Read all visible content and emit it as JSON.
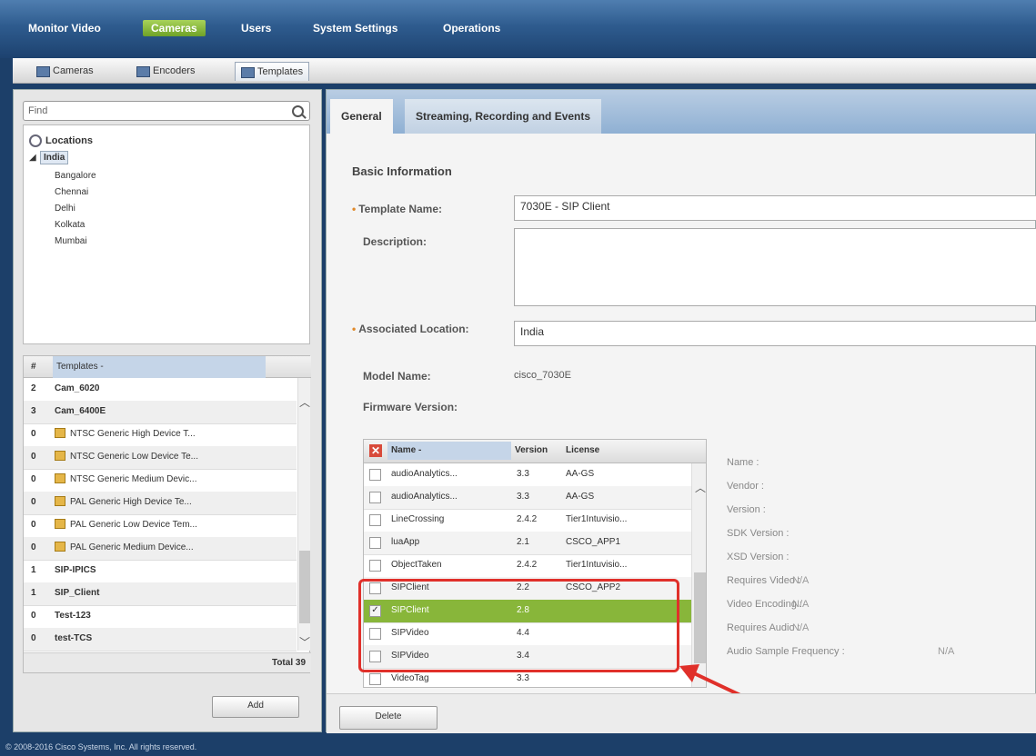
{
  "nav": {
    "tabs": [
      {
        "label": "Monitor Video",
        "active": false
      },
      {
        "label": "Cameras",
        "active": true
      },
      {
        "label": "Users",
        "active": false
      },
      {
        "label": "System Settings",
        "active": false
      },
      {
        "label": "Operations",
        "active": false
      }
    ]
  },
  "subnav": {
    "tabs": [
      {
        "label": "Cameras",
        "icon": "camera-icon",
        "active": false
      },
      {
        "label": "Encoders",
        "icon": "encoder-icon",
        "active": false
      },
      {
        "label": "Templates",
        "icon": "template-icon",
        "active": true
      }
    ]
  },
  "left": {
    "find_placeholder": "Find",
    "tree_root": "Locations",
    "tree_selected": "India",
    "tree_children": [
      "Bangalore",
      "Chennai",
      "Delhi",
      "Kolkata",
      "Mumbai"
    ],
    "grid_header": {
      "col1": "#",
      "col2": "Templates -"
    },
    "templates": [
      {
        "count": "2",
        "name": "Cam_6020",
        "locked": false
      },
      {
        "count": "3",
        "name": "Cam_6400E",
        "locked": false
      },
      {
        "count": "0",
        "name": "NTSC Generic High Device T...",
        "locked": true
      },
      {
        "count": "0",
        "name": "NTSC Generic Low Device Te...",
        "locked": true
      },
      {
        "count": "0",
        "name": "NTSC Generic Medium Devic...",
        "locked": true
      },
      {
        "count": "0",
        "name": "PAL Generic High Device Te...",
        "locked": true
      },
      {
        "count": "0",
        "name": "PAL Generic Low Device Tem...",
        "locked": true
      },
      {
        "count": "0",
        "name": "PAL Generic Medium Device...",
        "locked": true
      },
      {
        "count": "1",
        "name": "SIP-IPICS",
        "locked": false
      },
      {
        "count": "1",
        "name": "SIP_Client",
        "locked": false
      },
      {
        "count": "0",
        "name": "Test-123",
        "locked": false
      },
      {
        "count": "0",
        "name": "test-TCS",
        "locked": false
      }
    ],
    "total": "Total 39",
    "add_label": "Add"
  },
  "right": {
    "tabs": [
      "General",
      "Streaming, Recording and Events"
    ],
    "section_title": "Basic Information",
    "template_name_label": "Template Name:",
    "template_name_value": "7030E - SIP Client",
    "description_label": "Description:",
    "description_value": "",
    "location_label": "Associated Location:",
    "location_value": "India",
    "model_label": "Model Name:",
    "model_value": "cisco_7030E",
    "firmware_label": "Firmware Version:",
    "apps_header": {
      "name": "Name -",
      "version": "Version",
      "license": "License"
    },
    "apps": [
      {
        "name": "audioAnalytics...",
        "version": "3.3",
        "license": "AA-GS",
        "checked": false,
        "selected": false
      },
      {
        "name": "audioAnalytics...",
        "version": "3.3",
        "license": "AA-GS",
        "checked": false,
        "selected": false
      },
      {
        "name": "LineCrossing",
        "version": "2.4.2",
        "license": "Tier1Intuvisio...",
        "checked": false,
        "selected": false
      },
      {
        "name": "luaApp",
        "version": "2.1",
        "license": "CSCO_APP1",
        "checked": false,
        "selected": false
      },
      {
        "name": "ObjectTaken",
        "version": "2.4.2",
        "license": "Tier1Intuvisio...",
        "checked": false,
        "selected": false
      },
      {
        "name": "SIPClient",
        "version": "2.2",
        "license": "CSCO_APP2",
        "checked": false,
        "selected": false
      },
      {
        "name": "SIPClient",
        "version": "2.8",
        "license": "",
        "checked": true,
        "selected": true
      },
      {
        "name": "SIPVideo",
        "version": "4.4",
        "license": "",
        "checked": false,
        "selected": false
      },
      {
        "name": "SIPVideo",
        "version": "3.4",
        "license": "",
        "checked": false,
        "selected": false
      },
      {
        "name": "VideoTag",
        "version": "3.3",
        "license": "",
        "checked": false,
        "selected": false
      }
    ],
    "properties": [
      {
        "label": "Name :",
        "value": ""
      },
      {
        "label": "Vendor :",
        "value": ""
      },
      {
        "label": "Version :",
        "value": ""
      },
      {
        "label": "SDK Version :",
        "value": ""
      },
      {
        "label": "XSD Version :",
        "value": ""
      },
      {
        "label": "Requires Video :",
        "value": "N/A"
      },
      {
        "label": "Video Encoding :",
        "value": "N/A"
      },
      {
        "label": "Requires Audio :",
        "value": "N/A"
      },
      {
        "label": "Audio Sample Frequency :",
        "value": "N/A"
      }
    ],
    "delete_label": "Delete"
  },
  "footer": "© 2008-2016 Cisco Systems, Inc. All rights reserved.",
  "colors": {
    "accent": "#88b63a",
    "highlight": "#e0302a",
    "nav": "#1d426f"
  }
}
